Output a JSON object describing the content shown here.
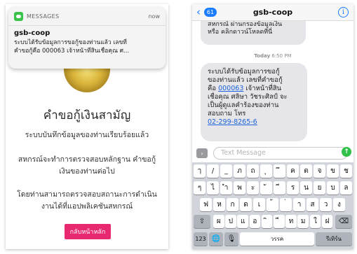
{
  "notification": {
    "app": "MESSAGES",
    "time": "now",
    "sender": "gsb-coop",
    "line1": "ระบบได้รับข้อมูลการขอกู้ของท่านแล้ว เลขที่",
    "line2": "คำขอกู้คือ 000063 เจ้าหน้าที่สินเชื่อคุณ ศ..."
  },
  "left": {
    "title": "คำขอกู้เงินสามัญ",
    "line_saved": "ระบบบันทึกข้อมูลของท่านเรียบร้อยแล้ว",
    "line_check1": "สหกรณ์จะทำการตรวจสอบหลักฐาน คำขอกู้",
    "line_check2": "เงินของท่านต่อไป",
    "line_status1": "โดยท่านสามารถตรวจสอบสถานะการดำเนิน",
    "line_status2": "งานได้ที่แอปพลิเคชันสหกรณ์",
    "button": "กลับหน้าหลัก"
  },
  "sms": {
    "back_badge": "61",
    "contact": "gsb-coop",
    "info": "i",
    "prev_line1": "สหกรณ์ ผ่านกรองข้อมูลเงิน",
    "prev_line2": "หรือ คลิกดาวน์โหลดที่นี่",
    "date_day": "Today",
    "date_time": "6:50 PM",
    "msg_l1": "ระบบได้รับข้อมูลการขอกู้",
    "msg_l2": "ของท่านแล้ว เลขที่คำขอกู้",
    "msg_l3a": "คือ ",
    "msg_l3_num": "000063",
    "msg_l3b": " เจ้าหน้าที่สิน",
    "msg_l4": "เชื่อคุณ ศลิษา วัชระศิลป์ จะ",
    "msg_l5": "เป็นผู้ดูแลคำร้องของท่าน",
    "msg_l6": "สอบถาม โทร",
    "msg_phone": "02-299-8265-6",
    "placeholder": "Text Message",
    "app_icon": "›",
    "send_icon": "↑"
  },
  "keyboard": {
    "row1": [
      "ๅ",
      "/",
      "_",
      "ภ",
      "ถ",
      "ุ",
      "ึ",
      "ค",
      "ต",
      "จ",
      "ข",
      "ช"
    ],
    "row2": [
      "ๆ",
      "ไ",
      "ำ",
      "พ",
      "ะ",
      "ั",
      "ี",
      "ร",
      "น",
      "ย",
      "บ",
      "ล"
    ],
    "row3": [
      "ฟ",
      "ห",
      "ก",
      "ด",
      "เ",
      "้",
      "่",
      "า",
      "ส",
      "ว",
      "ง"
    ],
    "row4": [
      "ผ",
      "ป",
      "แ",
      "อ",
      "ิ",
      "ื",
      "ท",
      "ม",
      "ใ",
      "ฝ"
    ],
    "shift": "⇧",
    "delete": "⌫",
    "numbers": "123",
    "globe": "🌐",
    "mic": "🎙",
    "space": "วรรค",
    "return": "รีเทิร์น"
  }
}
